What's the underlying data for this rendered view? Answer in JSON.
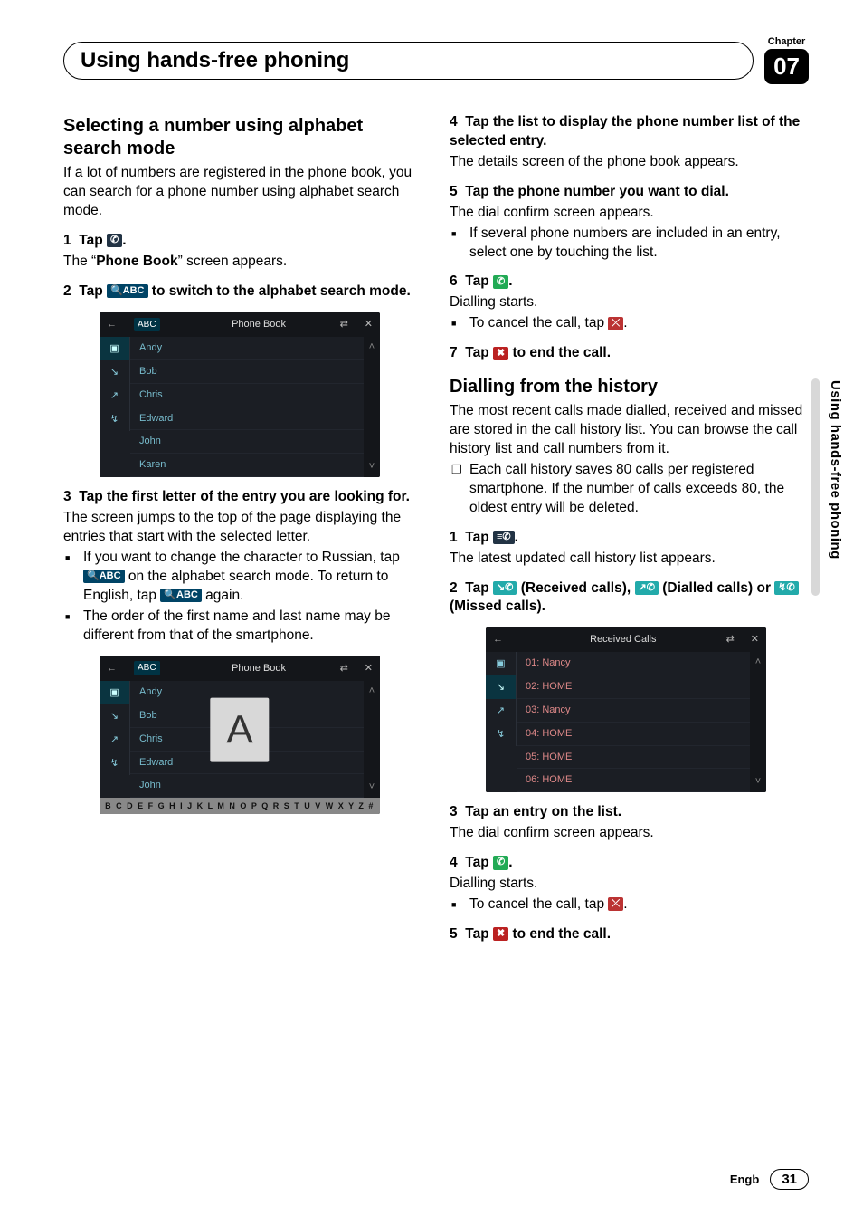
{
  "header": {
    "chapter_label": "Chapter",
    "chapter_number": "07",
    "title": "Using hands-free phoning"
  },
  "side_tab": "Using hands-free phoning",
  "footer": {
    "lang": "Engb",
    "page": "31"
  },
  "left": {
    "h2_select": "Selecting a number using alphabet search mode",
    "p_select_intro": "If a lot of numbers are registered in the phone book, you can search for a phone number using alphabet search mode.",
    "step1_prefix": "1",
    "step1_tap": "Tap ",
    "step1_period": ".",
    "step1_sub_a": "The “",
    "step1_sub_bold": "Phone Book",
    "step1_sub_b": "” screen appears.",
    "step2_prefix": "2",
    "step2_a": "Tap ",
    "step2_b": " to switch to the alphabet search mode.",
    "ss1": {
      "title": "Phone Book",
      "abc": "ABC",
      "rows": [
        "Andy",
        "Bob",
        "Chris",
        "Edward",
        "John",
        "Karen"
      ]
    },
    "step3_prefix": "3",
    "step3_text": "Tap the first letter of the entry you are looking for.",
    "step3_sub": "The screen jumps to the top of the page displaying the entries that start with the selected letter.",
    "bul1_a": "If you want to change the character to Russian, tap ",
    "bul1_b": " on the alphabet search mode. To return to English, tap ",
    "bul1_c": " again.",
    "bul2": "The order of the first name and last name may be different from that of the smartphone.",
    "ss2": {
      "title": "Phone Book",
      "abc": "ABC",
      "big_letter": "A",
      "rows": [
        "Andy",
        "Bob",
        "Chris",
        "Edward",
        "John"
      ],
      "alpha": "B C D E F G H I J K L M N O P Q R S T U V W X Y Z #"
    }
  },
  "right": {
    "step4_prefix": "4",
    "step4_text": "Tap the list to display the phone number list of the selected entry.",
    "step4_sub": "The details screen of the phone book appears.",
    "step5_prefix": "5",
    "step5_text": "Tap the phone number you want to dial.",
    "step5_sub": "The dial confirm screen appears.",
    "step5_bul": "If several phone numbers are included in an entry, select one by touching the list.",
    "step6_prefix": "6",
    "step6_a": "Tap ",
    "step6_b": ".",
    "step6_sub": "Dialling starts.",
    "step6_bul_a": "To cancel the call, tap ",
    "step6_bul_b": ".",
    "step7_prefix": "7",
    "step7_a": "Tap ",
    "step7_b": " to end the call.",
    "h2_hist": "Dialling from the history",
    "hist_intro": "The most recent calls made dialled, received and missed are stored in the call history list. You can browse the call history list and call numbers from it.",
    "hist_note": "Each call history saves 80 calls per registered smartphone. If the number of calls exceeds 80, the oldest entry will be deleted.",
    "h_step1_prefix": "1",
    "h_step1_a": "Tap ",
    "h_step1_b": ".",
    "h_step1_sub": "The latest updated call history list appears.",
    "h_step2_prefix": "2",
    "h_step2_a": "Tap ",
    "h_step2_b": " (Received calls), ",
    "h_step2_c": " (Dialled calls) or ",
    "h_step2_d": " (Missed calls).",
    "ss3": {
      "title": "Received Calls",
      "rows": [
        "01: Nancy",
        "02: HOME",
        "03: Nancy",
        "04: HOME",
        "05: HOME",
        "06: HOME"
      ]
    },
    "h_step3_prefix": "3",
    "h_step3_text": "Tap an entry on the list.",
    "h_step3_sub": "The dial confirm screen appears.",
    "h_step4_prefix": "4",
    "h_step4_a": "Tap ",
    "h_step4_b": ".",
    "h_step4_sub": "Dialling starts.",
    "h_step4_bul_a": "To cancel the call, tap ",
    "h_step4_bul_b": ".",
    "h_step5_prefix": "5",
    "h_step5_a": "Tap ",
    "h_step5_b": " to end the call."
  },
  "icons": {
    "book": "✆",
    "abc": "🔍ABC",
    "dial": "✆",
    "hangup": "✖",
    "history": "≡✆",
    "received": "↘✆",
    "dialled": "↗✆",
    "missed": "↯✆",
    "cancel": "⤫"
  }
}
